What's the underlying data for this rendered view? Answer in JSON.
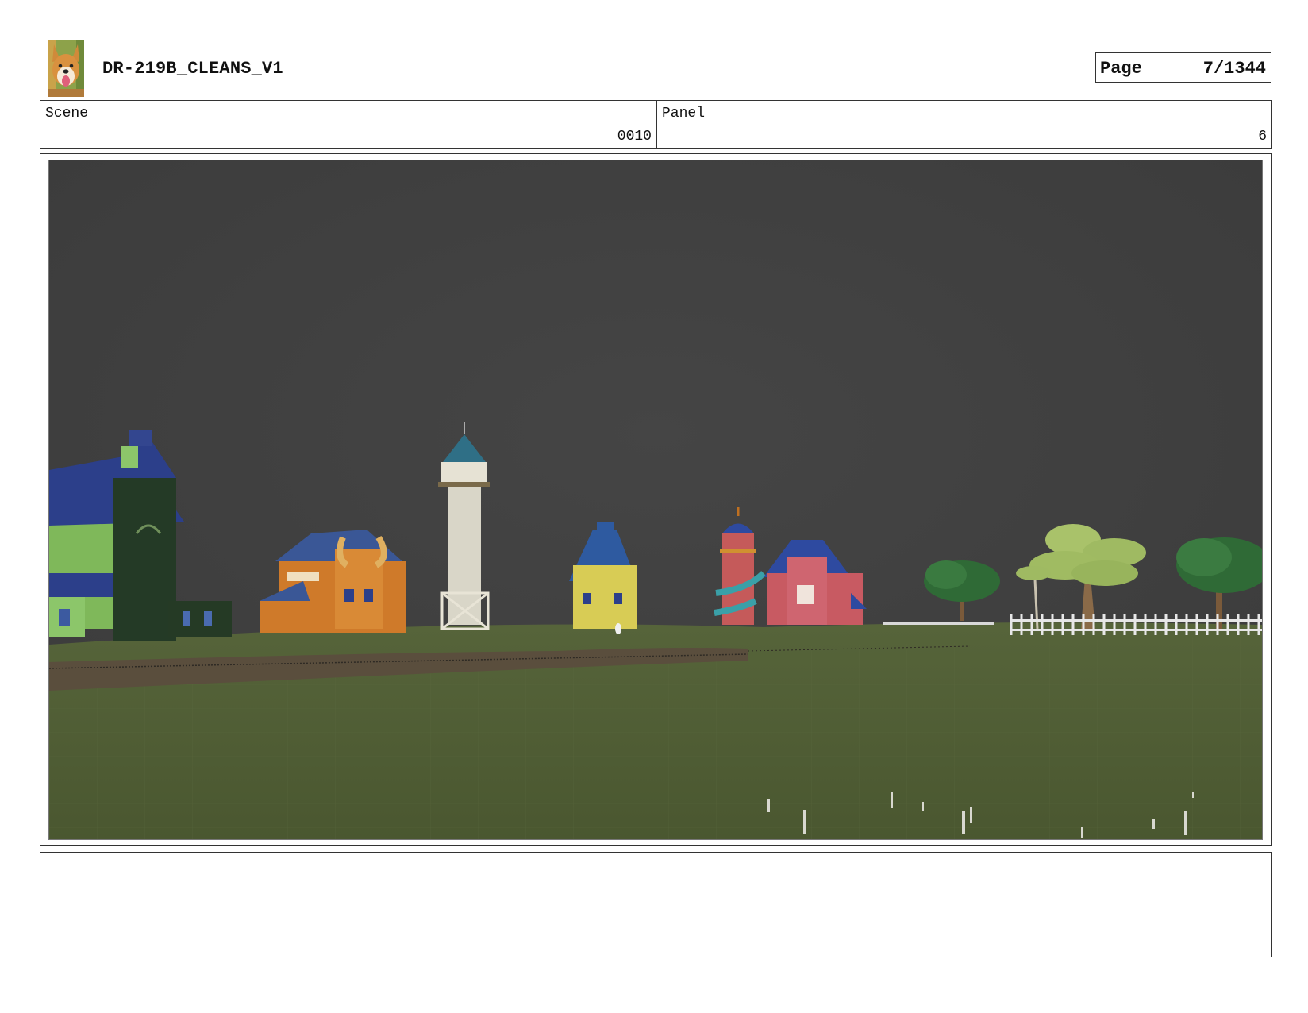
{
  "header": {
    "title": "DR-219B_CLEANS_V1",
    "page_label": "Page",
    "page_number": "7/1344",
    "logo_icon": "dog-avatar-icon"
  },
  "info": {
    "scene_label": "Scene",
    "scene_value": "0010",
    "panel_label": "Panel",
    "panel_value": "6"
  },
  "viewport": {
    "sky_color": "#404040",
    "ground_color": "#4f5d33",
    "path_color": "#5a4a3a"
  }
}
